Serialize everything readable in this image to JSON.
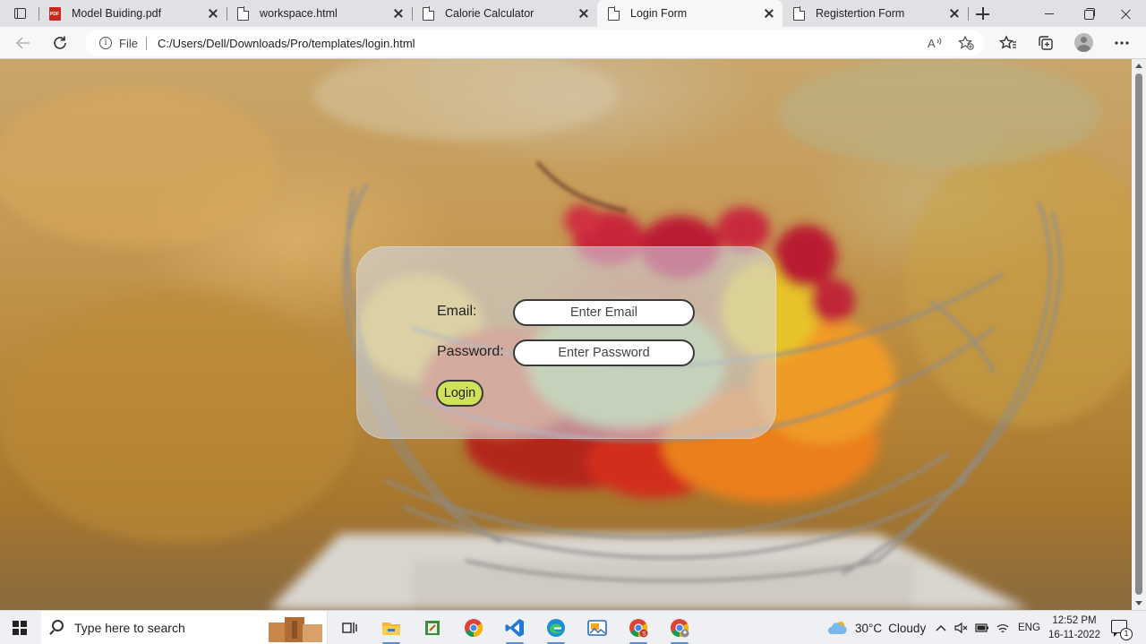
{
  "browser": {
    "tabs": [
      {
        "title": "Model Buiding.pdf",
        "icon": "pdf-icon",
        "active": false
      },
      {
        "title": "workspace.html",
        "icon": "page-icon",
        "active": false
      },
      {
        "title": "Calorie Calculator",
        "icon": "page-icon",
        "active": false
      },
      {
        "title": "Login Form",
        "icon": "page-icon",
        "active": true
      },
      {
        "title": "Registertion Form",
        "icon": "page-icon",
        "active": false
      }
    ],
    "address_bar": {
      "scheme_label": "File",
      "url": "C:/Users/Dell/Downloads/Pro/templates/login.html"
    }
  },
  "page": {
    "form": {
      "email_label": "Email:",
      "email_placeholder": "Enter Email",
      "password_label": "Password:",
      "password_placeholder": "Enter Password",
      "login_button": "Login"
    },
    "colors": {
      "button_fill": "#cfe25a",
      "card_tint": "#d2def0"
    }
  },
  "taskbar": {
    "search_placeholder": "Type here to search",
    "weather": {
      "temperature": "30°C",
      "condition": "Cloudy"
    },
    "language": "ENG",
    "time": "12:52 PM",
    "date": "16-11-2022",
    "notification_count": "1"
  }
}
